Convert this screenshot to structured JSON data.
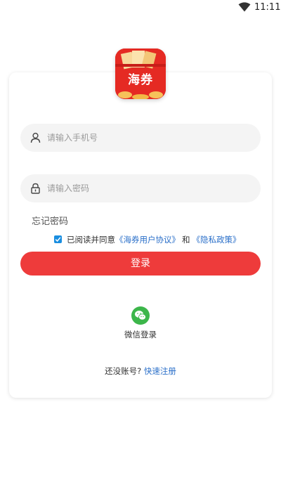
{
  "status_bar": {
    "time": "11:11"
  },
  "logo": {
    "text": "海券"
  },
  "login_form": {
    "phone_placeholder": "请输入手机号",
    "phone_value": "",
    "password_placeholder": "请输入密码",
    "password_value": "",
    "forgot_password": "忘记密码"
  },
  "agreement": {
    "checked": true,
    "prefix": "已阅读并同意",
    "user_agreement": "《海券用户协议》",
    "and": "和",
    "privacy_policy": "《隐私政策》"
  },
  "login_button": "登录",
  "wechat_login": "微信登录",
  "register": {
    "prompt": "还没账号?",
    "link": "快速注册"
  },
  "colors": {
    "brand_red": "#ee3b3b",
    "link_blue": "#2a6fc9",
    "wechat_green": "#3cb64a"
  }
}
